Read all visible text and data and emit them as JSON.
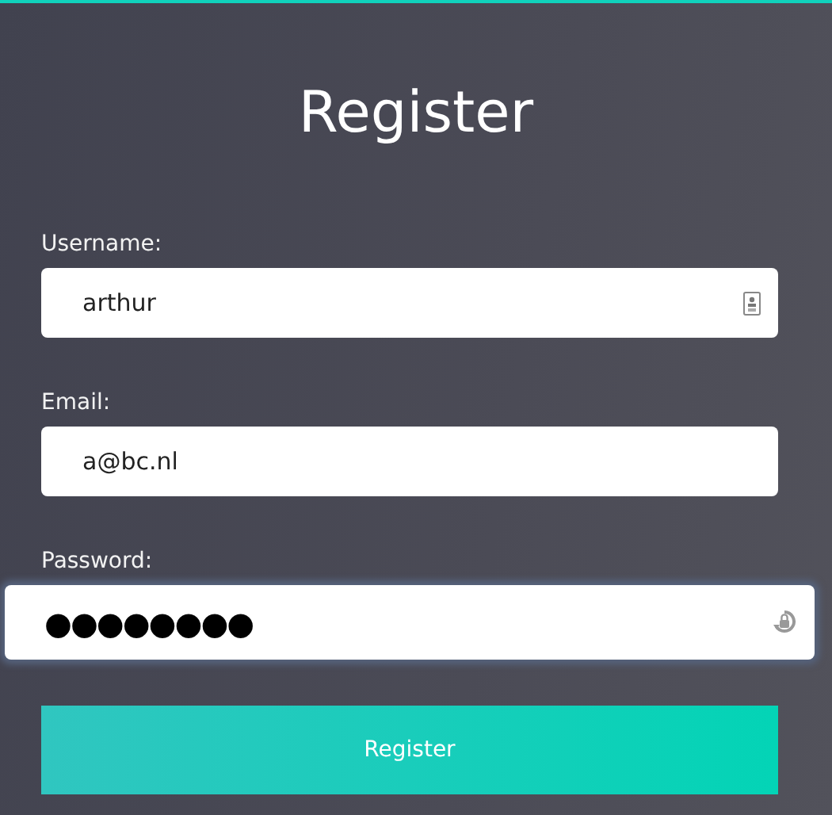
{
  "title": "Register",
  "fields": [
    {
      "kind": "username",
      "label": "Username:",
      "value": "arthur",
      "focused": false
    },
    {
      "kind": "email",
      "label": "Email:",
      "value": "a@bc.nl",
      "focused": false
    },
    {
      "kind": "password",
      "label": "Password:",
      "value": "●●●●●●●●",
      "focused": true
    }
  ],
  "submit": "Register"
}
